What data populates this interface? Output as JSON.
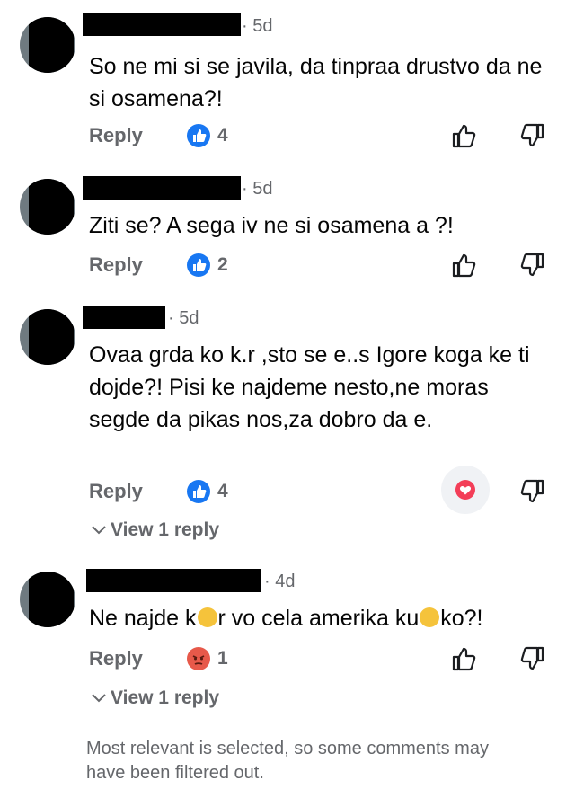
{
  "comments": [
    {
      "time": "· 5d",
      "text": "So ne mi si se javila, da tinpraa drustvo da ne si osamena?!",
      "reply_label": "Reply",
      "reaction": "like",
      "reaction_count": "4"
    },
    {
      "time": "· 5d",
      "text": "Ziti se? A sega iv ne si osamena a ?!",
      "reply_label": "Reply",
      "reaction": "like",
      "reaction_count": "2"
    },
    {
      "time": "· 5d",
      "text": "Ovaa grda ko k.r ,sto se e..s Igore koga ke ti dojde?! Pisi ke najdeme nesto,ne moras segde da pikas nos,za dobro da e.",
      "reply_label": "Reply",
      "reaction": "like",
      "reaction_count": "4",
      "user_reaction": "love",
      "view_replies": "View 1 reply"
    },
    {
      "time": "· 4d",
      "text_part1": "Ne najde k",
      "text_part2": "r vo cela amerika ku",
      "text_part3": "ko?!",
      "reply_label": "Reply",
      "reaction": "angry",
      "reaction_count": "1",
      "view_replies": "View 1 reply"
    }
  ],
  "footer_note": "Most relevant is selected, so some comments may have been filtered out.",
  "colors": {
    "like_blue": "#1877f2",
    "love_red": "#f33e58",
    "angry_red": "#e7594a",
    "secondary_text": "#65676b"
  }
}
